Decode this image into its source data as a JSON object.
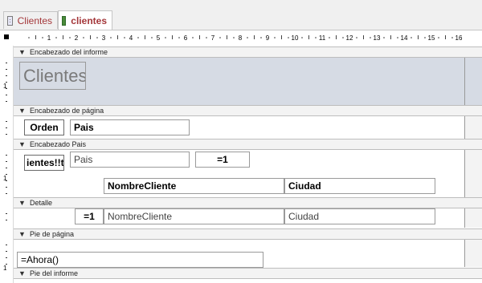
{
  "tabs": [
    {
      "label": "Clientes",
      "icon": "report-icon",
      "active": false
    },
    {
      "label": "clientes",
      "icon": "form-icon",
      "active": true
    }
  ],
  "ruler": {
    "marks": [
      "1",
      "2",
      "3",
      "4",
      "5",
      "6",
      "7",
      "8",
      "9",
      "10",
      "11",
      "12",
      "13",
      "14",
      "15",
      "16"
    ],
    "vertical_marks": [
      "1",
      "1",
      "1",
      "1"
    ]
  },
  "sections": {
    "report_header": "Encabezado del informe",
    "page_header": "Encabezado de página",
    "group_header": "Encabezado Pais",
    "detail": "Detalle",
    "page_footer": "Pie de página",
    "report_footer": "Pie del informe"
  },
  "controls": {
    "title": "Clientes",
    "orden_label": "Orden",
    "pais_label": "Pais",
    "group_expr": "ientes!!te",
    "pais_field": "Pais",
    "counter_group": "=1",
    "nombre_label": "NombreCliente",
    "ciudad_label": "Ciudad",
    "counter_detail": "=1",
    "nombre_field": "NombreCliente",
    "ciudad_field": "Ciudad",
    "ahora_field": "=Ahora()"
  },
  "colors": {
    "tab_text": "#a4373a",
    "report_header_bg": "#d6dbe4",
    "section_header_bg": "#f3f3f3"
  }
}
